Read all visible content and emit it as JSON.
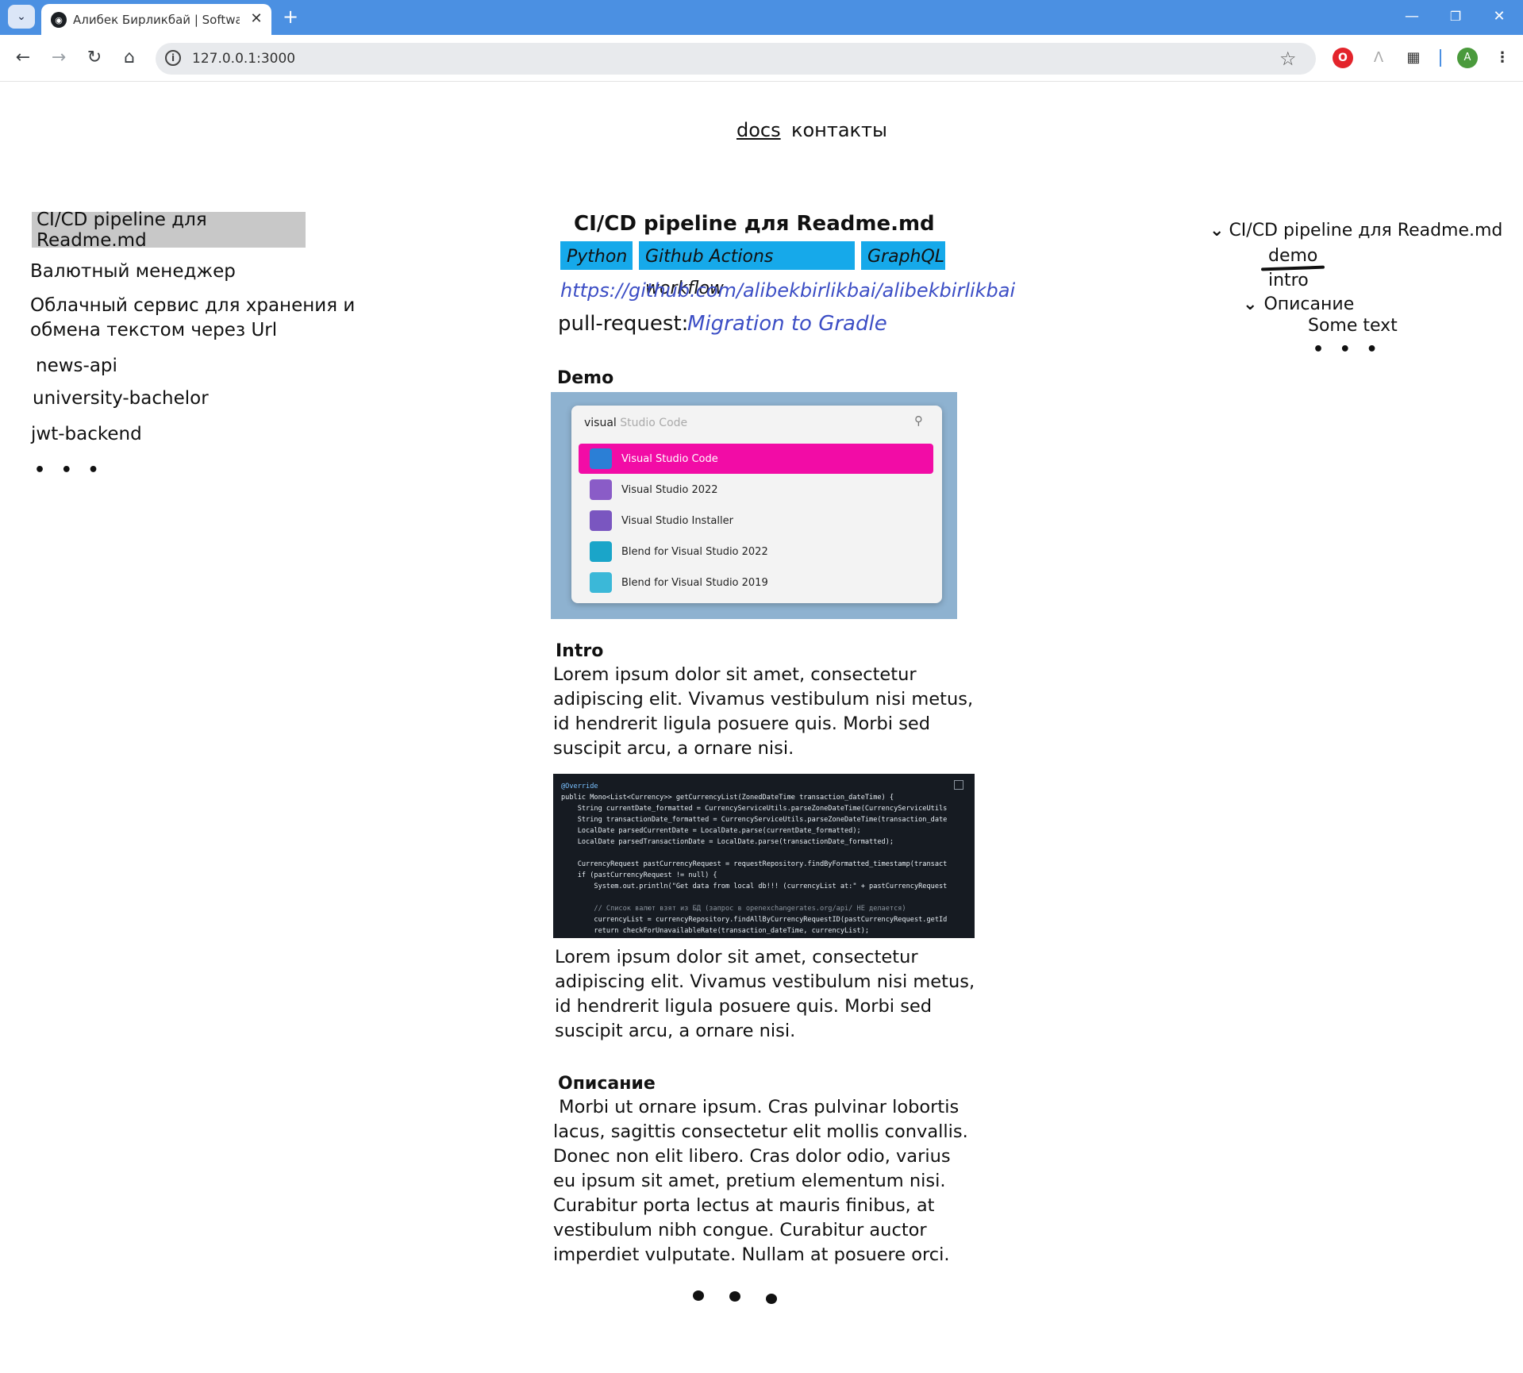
{
  "browser": {
    "tab_title": "Алибек Бирликбай | Software E",
    "url": "127.0.0.1:3000",
    "new_tab_symbol": "+",
    "profile_initial": "A"
  },
  "topnav": {
    "docs": "docs",
    "contacts": "контакты"
  },
  "sidebar": {
    "items": [
      {
        "label": "CI/CD pipeline для Readme.md"
      },
      {
        "label": "Валютный менеджер"
      },
      {
        "label": "Облачный сервис для хранения и обмена текстом через Url"
      },
      {
        "label": "news-api"
      },
      {
        "label": "university-bachelor"
      },
      {
        "label": "jwt-backend"
      }
    ],
    "more": "• • •"
  },
  "content": {
    "title": "CI/CD pipeline для Readme.md",
    "tags": [
      "Python",
      "Github Actions workflow",
      "GraphQL"
    ],
    "repo_link": "https://github.com/alibekbirlikbai/alibekbirlikbai",
    "pr_label": "pull-request:",
    "pr_link": "Migration to Gradle",
    "demo_heading": "Demo",
    "demo_image": {
      "search_typed": "visual",
      "search_hint": " Studio Code",
      "items": [
        "Visual Studio Code",
        "Visual Studio 2022",
        "Visual Studio Installer",
        "Blend for Visual Studio 2022",
        "Blend for Visual Studio 2019"
      ],
      "selected_color": "#f20ca6"
    },
    "intro_heading": "Intro",
    "intro_text": "Lorem ipsum dolor sit amet, consectetur adipiscing elit. Vivamus vestibulum nisi metus, id hendrerit ligula posuere quis. Morbi sed suscipit arcu, a ornare nisi.",
    "code_lines": [
      "@Override",
      "public Mono<List<Currency>> getCurrencyList(ZonedDateTime transaction_dateTime) {",
      "    String currentDate_formatted = CurrencyServiceUtils.parseZoneDateTime(CurrencyServiceUtils",
      "    String transactionDate_formatted = CurrencyServiceUtils.parseZoneDateTime(transaction_date",
      "    LocalDate parsedCurrentDate = LocalDate.parse(currentDate_formatted);",
      "    LocalDate parsedTransactionDate = LocalDate.parse(transactionDate_formatted);",
      "",
      "    CurrencyRequest pastCurrencyRequest = requestRepository.findByFormatted_timestamp(transact",
      "    if (pastCurrencyRequest != null) {",
      "        System.out.println(\"Get data from local db!!! (currencyList at:\" + pastCurrencyRequest",
      "",
      "        // Список валют взят из БД (запрос в openexchangerates.org/api/ НЕ делается)",
      "        currencyList = currencyRepository.findAllByCurrencyRequestID(pastCurrencyRequest.getId",
      "        return checkForUnavailableRate(transaction_dateTime, currencyList);"
    ],
    "after_code_text": "Lorem ipsum dolor sit amet, consectetur adipiscing elit. Vivamus vestibulum nisi metus, id hendrerit ligula posuere quis. Morbi sed suscipit arcu, a ornare nisi.",
    "description_heading": "Описание",
    "description_text": " Morbi ut ornare ipsum. Cras pulvinar lobortis lacus, sagittis consectetur elit mollis convallis. Donec non elit libero. Cras dolor odio, varius eu ipsum sit amet, pretium elementum nisi. Curabitur porta lectus at mauris finibus, at vestibulum nibh congue. Curabitur auctor imperdiet vulputate. Nullam at posuere orci."
  },
  "toc": {
    "root": "CI/CD pipeline для  Readme.md",
    "demo": "demo",
    "intro": "intro",
    "description": "Описание",
    "some_text": "Some text",
    "more": "• • •"
  },
  "colors": {
    "tab_strip": "#4b90e2",
    "tag_bg": "#16a9ea",
    "link": "#3c4ec5",
    "sidebar_active_bg": "#c8c8c8"
  }
}
